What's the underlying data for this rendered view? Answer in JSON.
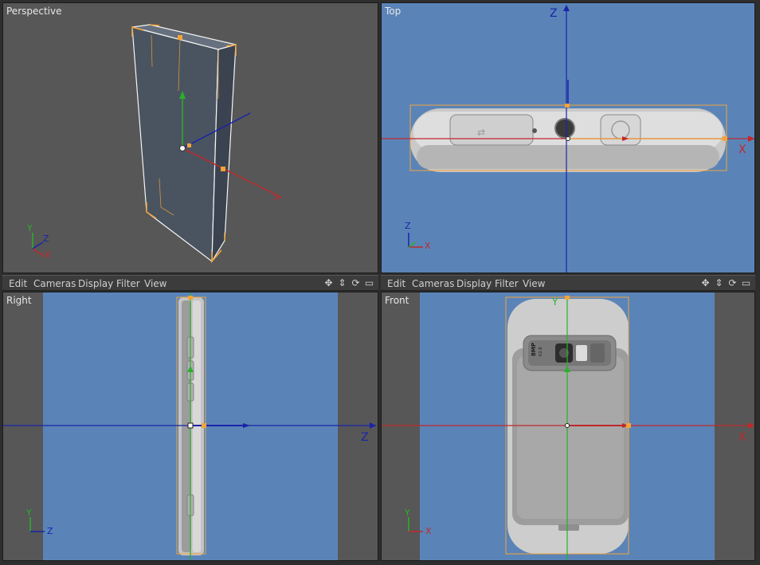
{
  "viewports": {
    "perspective": {
      "label": "Perspective"
    },
    "top": {
      "label": "Top",
      "axis_h": "X",
      "axis_v": "Z"
    },
    "right": {
      "label": "Right",
      "axis_h": "Z",
      "axis_v": "Y"
    },
    "front": {
      "label": "Front",
      "axis_h": "X",
      "axis_v": "Y"
    }
  },
  "gizmo": {
    "x": "X",
    "y": "Y",
    "z": "Z"
  },
  "menu": {
    "edit": "Edit",
    "cameras": "Cameras",
    "display": "Display",
    "filter": "Filter",
    "view": "View"
  },
  "camera_text": {
    "megapixels": "8MP",
    "subtext": "f/2.8"
  },
  "icons": [
    "move-icon",
    "dolly-icon",
    "rotate-icon",
    "maximize-icon"
  ],
  "colors": {
    "viewport_gray": "#575757",
    "viewport_blue": "#5a84b8",
    "selection": "#f2a33a",
    "axis_x": "#c0282b",
    "axis_y": "#2bb02b",
    "axis_z": "#1a24a8"
  }
}
